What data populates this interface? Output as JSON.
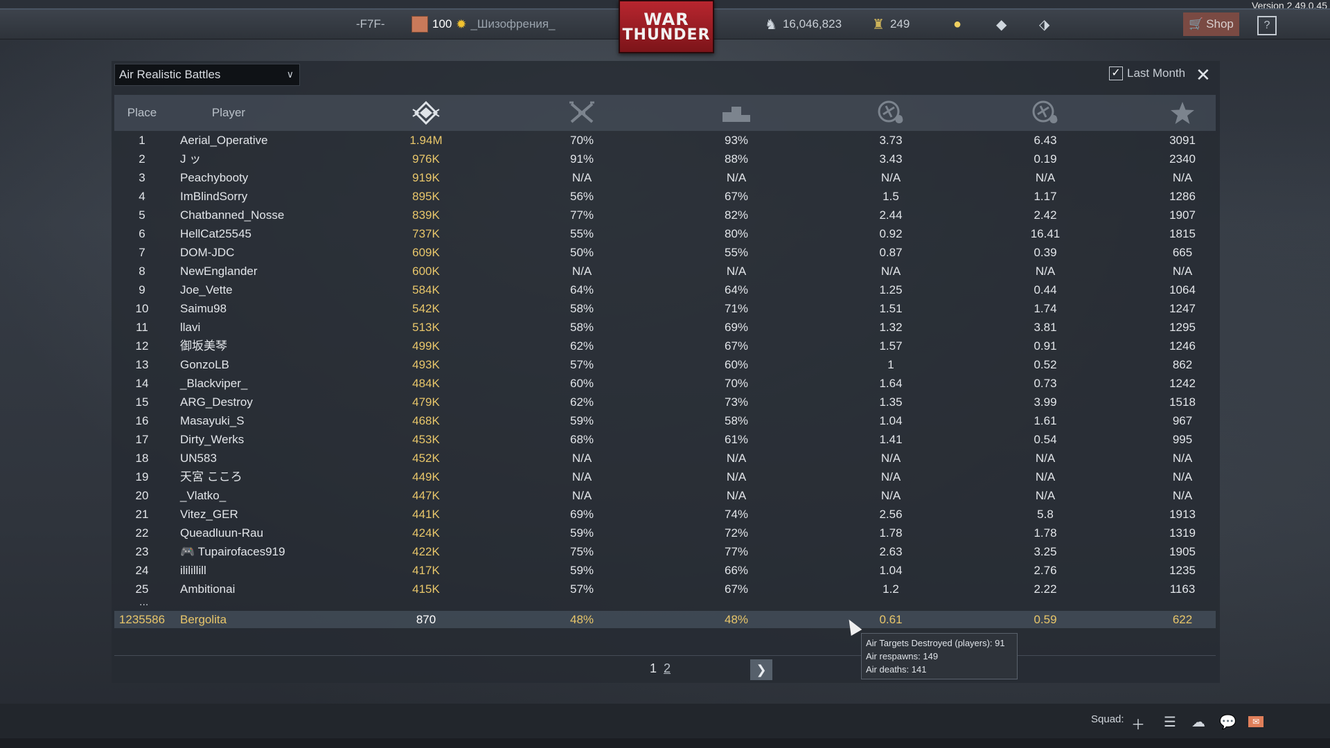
{
  "version": "Version 2.49.0.45",
  "topbar": {
    "clan_tag": "-F7F-",
    "level": "100",
    "nickname": "_Шизофрения_",
    "logo_line1": "WAR",
    "logo_line2": "THUNDER",
    "silver_lions": "16,046,823",
    "golden_eagles": "249",
    "shop_label": "Shop",
    "help_label": "?"
  },
  "mode_select": {
    "value": "Air Realistic Battles"
  },
  "last_month_label": "Last Month",
  "table": {
    "headers": {
      "place": "Place",
      "player": "Player"
    },
    "column_icons": [
      "efficiency-icon",
      "win-rate-icon",
      "podium-icon",
      "air-kills-per-spawn-icon",
      "ground-kills-per-spawn-icon",
      "battles-star-icon"
    ],
    "rows": [
      {
        "place": "1",
        "player": "Aerial_Operative",
        "score": "1.94M",
        "v1": "70%",
        "v2": "93%",
        "v3": "3.73",
        "v4": "6.43",
        "v5": "3091"
      },
      {
        "place": "2",
        "player": "J ッ",
        "score": "976K",
        "v1": "91%",
        "v2": "88%",
        "v3": "3.43",
        "v4": "0.19",
        "v5": "2340"
      },
      {
        "place": "3",
        "player": "Peachybooty",
        "score": "919K",
        "v1": "N/A",
        "v2": "N/A",
        "v3": "N/A",
        "v4": "N/A",
        "v5": "N/A"
      },
      {
        "place": "4",
        "player": "ImBlindSorry",
        "score": "895K",
        "v1": "56%",
        "v2": "67%",
        "v3": "1.5",
        "v4": "1.17",
        "v5": "1286"
      },
      {
        "place": "5",
        "player": "Chatbanned_Nosse",
        "score": "839K",
        "v1": "77%",
        "v2": "82%",
        "v3": "2.44",
        "v4": "2.42",
        "v5": "1907"
      },
      {
        "place": "6",
        "player": "HellCat25545",
        "score": "737K",
        "v1": "55%",
        "v2": "80%",
        "v3": "0.92",
        "v4": "16.41",
        "v5": "1815"
      },
      {
        "place": "7",
        "player": "DOM-JDC",
        "score": "609K",
        "v1": "50%",
        "v2": "55%",
        "v3": "0.87",
        "v4": "0.39",
        "v5": "665"
      },
      {
        "place": "8",
        "player": "NewEnglander",
        "score": "600K",
        "v1": "N/A",
        "v2": "N/A",
        "v3": "N/A",
        "v4": "N/A",
        "v5": "N/A"
      },
      {
        "place": "9",
        "player": "Joe_Vette",
        "score": "584K",
        "v1": "64%",
        "v2": "64%",
        "v3": "1.25",
        "v4": "0.44",
        "v5": "1064"
      },
      {
        "place": "10",
        "player": "Saimu98",
        "score": "542K",
        "v1": "58%",
        "v2": "71%",
        "v3": "1.51",
        "v4": "1.74",
        "v5": "1247"
      },
      {
        "place": "11",
        "player": "llavi",
        "score": "513K",
        "v1": "58%",
        "v2": "69%",
        "v3": "1.32",
        "v4": "3.81",
        "v5": "1295"
      },
      {
        "place": "12",
        "player": "御坂美琴",
        "score": "499K",
        "v1": "62%",
        "v2": "67%",
        "v3": "1.57",
        "v4": "0.91",
        "v5": "1246"
      },
      {
        "place": "13",
        "player": "GonzoLB",
        "score": "493K",
        "v1": "57%",
        "v2": "60%",
        "v3": "1",
        "v4": "0.52",
        "v5": "862"
      },
      {
        "place": "14",
        "player": "_Blackviper_",
        "score": "484K",
        "v1": "60%",
        "v2": "70%",
        "v3": "1.64",
        "v4": "0.73",
        "v5": "1242"
      },
      {
        "place": "15",
        "player": "ARG_Destroy",
        "score": "479K",
        "v1": "62%",
        "v2": "73%",
        "v3": "1.35",
        "v4": "3.99",
        "v5": "1518"
      },
      {
        "place": "16",
        "player": "Masayuki_S",
        "score": "468K",
        "v1": "59%",
        "v2": "58%",
        "v3": "1.04",
        "v4": "1.61",
        "v5": "967"
      },
      {
        "place": "17",
        "player": "Dirty_Werks",
        "score": "453K",
        "v1": "68%",
        "v2": "61%",
        "v3": "1.41",
        "v4": "0.54",
        "v5": "995"
      },
      {
        "place": "18",
        "player": "UN583",
        "score": "452K",
        "v1": "N/A",
        "v2": "N/A",
        "v3": "N/A",
        "v4": "N/A",
        "v5": "N/A"
      },
      {
        "place": "19",
        "player": "天宮 こころ",
        "score": "449K",
        "v1": "N/A",
        "v2": "N/A",
        "v3": "N/A",
        "v4": "N/A",
        "v5": "N/A"
      },
      {
        "place": "20",
        "player": "_Vlatko_",
        "score": "447K",
        "v1": "N/A",
        "v2": "N/A",
        "v3": "N/A",
        "v4": "N/A",
        "v5": "N/A"
      },
      {
        "place": "21",
        "player": "Vitez_GER",
        "score": "441K",
        "v1": "69%",
        "v2": "74%",
        "v3": "2.56",
        "v4": "5.8",
        "v5": "1913"
      },
      {
        "place": "22",
        "player": "Queadluun-Rau",
        "score": "424K",
        "v1": "59%",
        "v2": "72%",
        "v3": "1.78",
        "v4": "1.78",
        "v5": "1319"
      },
      {
        "place": "23",
        "player": "🎮 Tupairofaces919",
        "score": "422K",
        "v1": "75%",
        "v2": "77%",
        "v3": "2.63",
        "v4": "3.25",
        "v5": "1905"
      },
      {
        "place": "24",
        "player": "ililillill",
        "score": "417K",
        "v1": "59%",
        "v2": "66%",
        "v3": "1.04",
        "v4": "2.76",
        "v5": "1235"
      },
      {
        "place": "25",
        "player": "Ambitionai",
        "score": "415K",
        "v1": "57%",
        "v2": "67%",
        "v3": "1.2",
        "v4": "2.22",
        "v5": "1163"
      }
    ],
    "ellipsis": "...",
    "me": {
      "place": "1235586",
      "player": "Bergolita",
      "score": "870",
      "v1": "48%",
      "v2": "48%",
      "v3": "0.61",
      "v4": "0.59",
      "v5": "622"
    }
  },
  "pager": {
    "page1": "1",
    "page2": "2"
  },
  "tooltip": {
    "line1": "Air Targets Destroyed (players): 91",
    "line2": "Air respawns: 149",
    "line3": "Air deaths: 141"
  },
  "bottombar": {
    "squad_label": "Squad:"
  }
}
